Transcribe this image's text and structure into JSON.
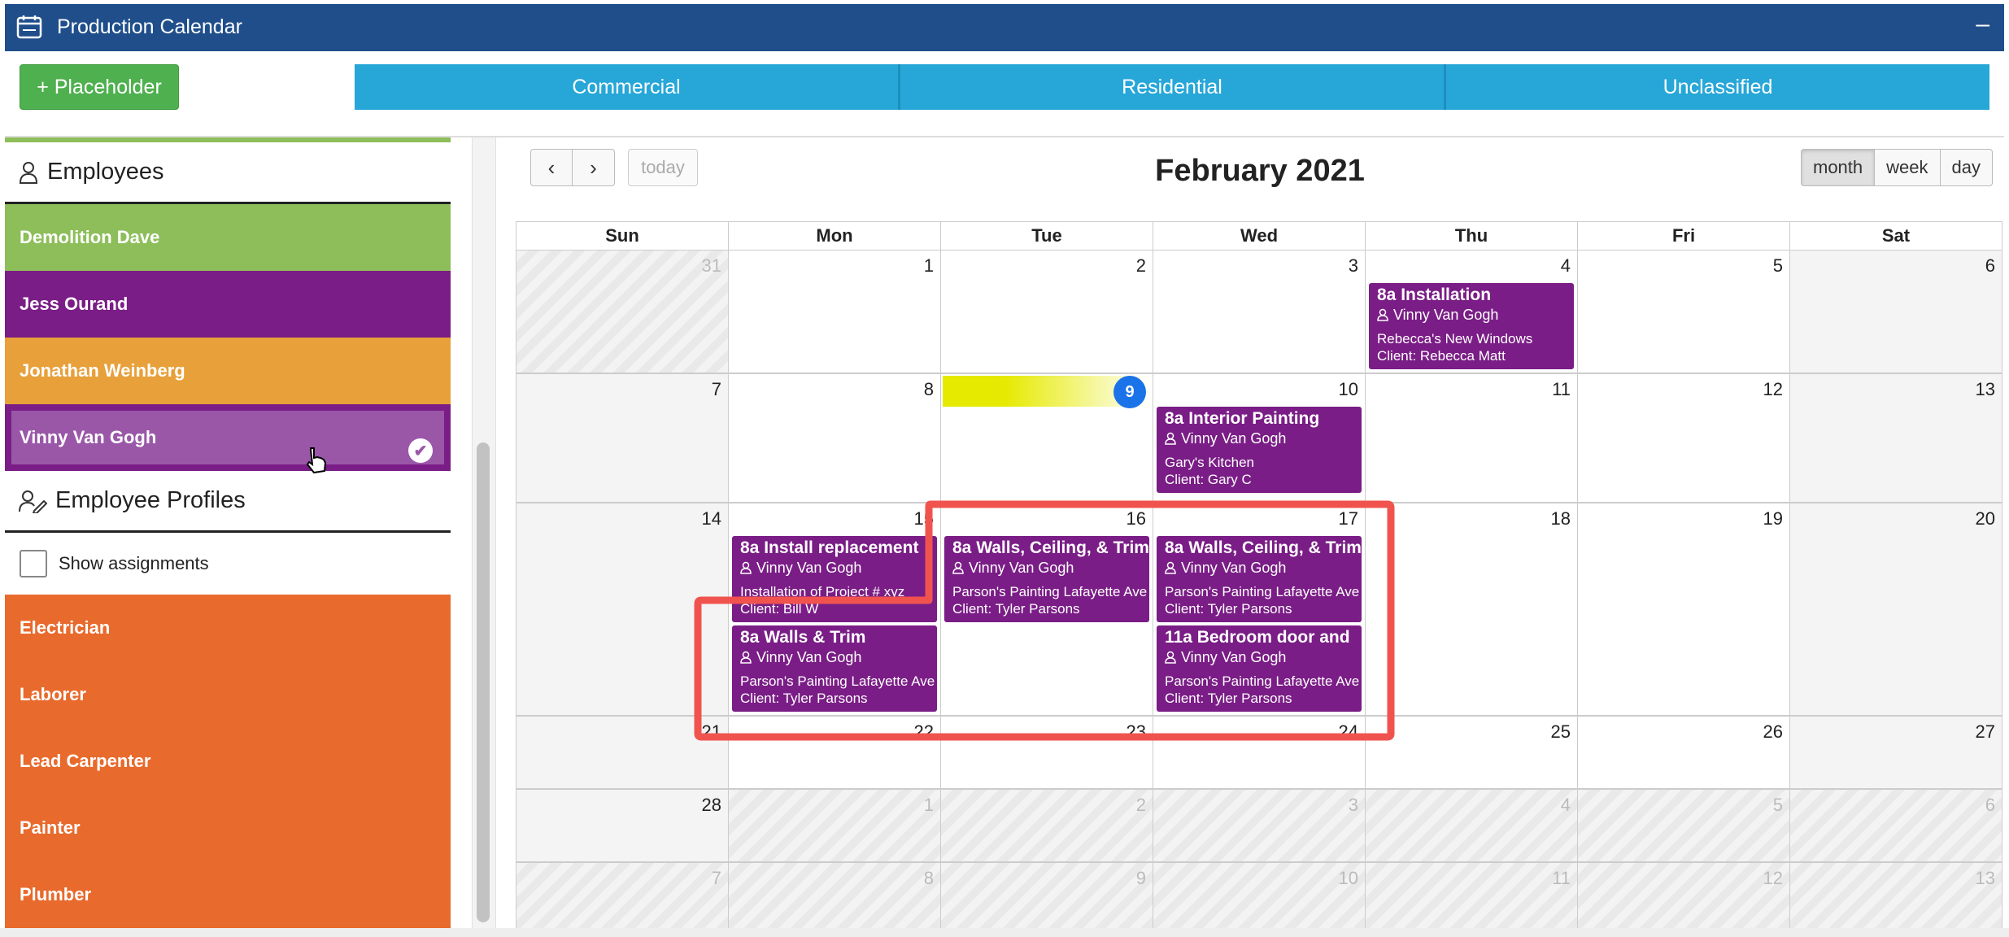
{
  "window": {
    "title": "Production Calendar",
    "minimize": "–"
  },
  "toolbar": {
    "placeholder_label": "+ Placeholder",
    "tabs": [
      {
        "label": "Commercial"
      },
      {
        "label": "Residential"
      },
      {
        "label": "Unclassified"
      }
    ]
  },
  "sidebar": {
    "employees_heading": "Employees",
    "employees": [
      {
        "name": "Demolition Dave",
        "color": "#8dbe5a"
      },
      {
        "name": "Jess Ourand",
        "color": "#7a1d86"
      },
      {
        "name": "Jonathan Weinberg",
        "color": "#e8a03a"
      },
      {
        "name": "Vinny Van Gogh",
        "color": "#9a57a8",
        "selected": true
      }
    ],
    "profiles_heading": "Employee Profiles",
    "show_assignments": "Show assignments",
    "roles": [
      {
        "name": "Electrician"
      },
      {
        "name": "Laborer"
      },
      {
        "name": "Lead Carpenter"
      },
      {
        "name": "Painter"
      },
      {
        "name": "Plumber"
      }
    ]
  },
  "calendar": {
    "month_title": "February 2021",
    "today_label": "today",
    "prev_icon": "‹",
    "next_icon": "›",
    "views": [
      {
        "label": "month",
        "active": true
      },
      {
        "label": "week"
      },
      {
        "label": "day"
      }
    ],
    "days_of_week": [
      "Sun",
      "Mon",
      "Tue",
      "Wed",
      "Thu",
      "Fri",
      "Sat"
    ],
    "weeks": [
      {
        "days": [
          {
            "n": "31",
            "other": true
          },
          {
            "n": "1"
          },
          {
            "n": "2"
          },
          {
            "n": "3"
          },
          {
            "n": "4"
          },
          {
            "n": "5"
          },
          {
            "n": "6"
          }
        ]
      },
      {
        "days": [
          {
            "n": "7"
          },
          {
            "n": "8"
          },
          {
            "n": "9",
            "today": true
          },
          {
            "n": "10"
          },
          {
            "n": "11"
          },
          {
            "n": "12"
          },
          {
            "n": "13"
          }
        ]
      },
      {
        "days": [
          {
            "n": "14"
          },
          {
            "n": "15"
          },
          {
            "n": "16"
          },
          {
            "n": "17"
          },
          {
            "n": "18"
          },
          {
            "n": "19"
          },
          {
            "n": "20"
          }
        ]
      },
      {
        "days": [
          {
            "n": "21"
          },
          {
            "n": "22"
          },
          {
            "n": "23"
          },
          {
            "n": "24"
          },
          {
            "n": "25"
          },
          {
            "n": "26"
          },
          {
            "n": "27"
          }
        ]
      },
      {
        "days": [
          {
            "n": "28"
          },
          {
            "n": "1",
            "other": true
          },
          {
            "n": "2",
            "other": true
          },
          {
            "n": "3",
            "other": true
          },
          {
            "n": "4",
            "other": true
          },
          {
            "n": "5",
            "other": true
          },
          {
            "n": "6",
            "other": true
          }
        ]
      },
      {
        "days": [
          {
            "n": "7",
            "other": true
          },
          {
            "n": "8",
            "other": true
          },
          {
            "n": "9",
            "other": true
          },
          {
            "n": "10",
            "other": true
          },
          {
            "n": "11",
            "other": true
          },
          {
            "n": "12",
            "other": true
          },
          {
            "n": "13",
            "other": true
          }
        ]
      }
    ],
    "events": [
      {
        "week": 0,
        "day": 4,
        "slot": 0,
        "title": "8a Installation",
        "employee": "Vinny Van Gogh",
        "job": "Rebecca's New Windows",
        "client": "Client: Rebecca Matt"
      },
      {
        "week": 1,
        "day": 3,
        "slot": 0,
        "title": "8a Interior Painting",
        "employee": "Vinny Van Gogh",
        "job": "Gary's Kitchen",
        "client": "Client: Gary C"
      },
      {
        "week": 2,
        "day": 1,
        "slot": 0,
        "title": "8a Install replacement",
        "employee": "Vinny Van Gogh",
        "job": "Installation of Project # xyz",
        "client": "Client: Bill W"
      },
      {
        "week": 2,
        "day": 2,
        "slot": 0,
        "title": "8a Walls, Ceiling, & Trim",
        "employee": "Vinny Van Gogh",
        "job": "Parson's Painting Lafayette Ave",
        "client": "Client: Tyler Parsons"
      },
      {
        "week": 2,
        "day": 3,
        "slot": 0,
        "title": "8a Walls, Ceiling, & Trim",
        "employee": "Vinny Van Gogh",
        "job": "Parson's Painting Lafayette Ave",
        "client": "Client: Tyler Parsons"
      },
      {
        "week": 2,
        "day": 1,
        "slot": 1,
        "title": "8a Walls & Trim",
        "employee": "Vinny Van Gogh",
        "job": "Parson's Painting Lafayette Ave",
        "client": "Client: Tyler Parsons"
      },
      {
        "week": 2,
        "day": 3,
        "slot": 1,
        "title": "11a Bedroom door and",
        "employee": "Vinny Van Gogh",
        "job": "Parson's Painting Lafayette Ave",
        "client": "Client: Tyler Parsons"
      }
    ]
  }
}
